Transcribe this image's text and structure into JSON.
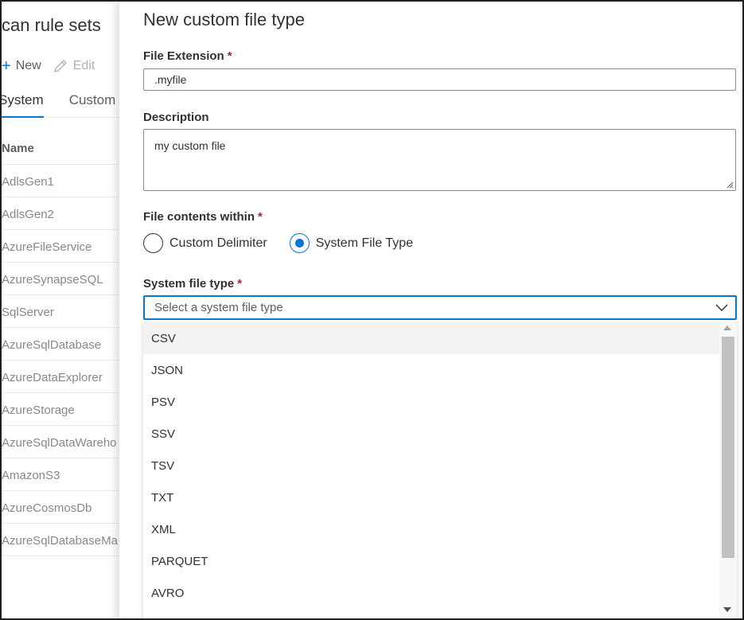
{
  "background_page": {
    "title": "can rule sets",
    "toolbar": {
      "new_label": "New",
      "edit_label": "Edit"
    },
    "tabs": [
      {
        "label": "System"
      },
      {
        "label": "Custom"
      }
    ],
    "column_header": "Name",
    "rows": [
      "AdlsGen1",
      "AdlsGen2",
      "AzureFileService",
      "AzureSynapseSQL",
      "SqlServer",
      "AzureSqlDatabase",
      "AzureDataExplorer",
      "AzureStorage",
      "AzureSqlDataWareho",
      "AmazonS3",
      "AzureCosmosDb",
      "AzureSqlDatabaseMa"
    ]
  },
  "panel": {
    "title": "New custom file type",
    "file_extension": {
      "label": "File Extension",
      "required_mark": "*",
      "value": ".myfile"
    },
    "description": {
      "label": "Description",
      "value": "my custom file"
    },
    "file_contents": {
      "label": "File contents within",
      "required_mark": "*",
      "options": [
        {
          "label": "Custom Delimiter",
          "checked": false
        },
        {
          "label": "System File Type",
          "checked": true
        }
      ]
    },
    "system_file_type": {
      "label": "System file type",
      "required_mark": "*",
      "placeholder": "Select a system file type",
      "options": [
        "CSV",
        "JSON",
        "PSV",
        "SSV",
        "TSV",
        "TXT",
        "XML",
        "PARQUET",
        "AVRO"
      ],
      "hovered_option": "CSV"
    }
  },
  "colors": {
    "accent": "#0078d4",
    "required": "#a4262c"
  },
  "icons": {
    "new": "plus-icon",
    "edit": "pencil-icon",
    "dropdown": "chevron-down-icon"
  }
}
